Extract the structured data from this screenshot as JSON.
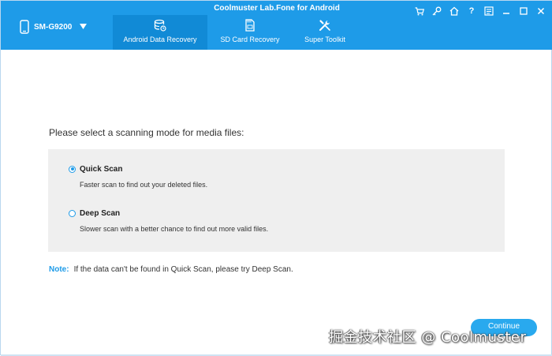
{
  "window": {
    "title": "Coolmuster Lab.Fone for Android",
    "controls": [
      "cart-icon",
      "key-icon",
      "home-icon",
      "help-icon",
      "feedback-icon",
      "minimize-icon",
      "maximize-icon",
      "close-icon"
    ]
  },
  "device": {
    "name": "SM-G9200"
  },
  "tabs": [
    {
      "label": "Android Data Recovery",
      "icon": "database-restore-icon",
      "active": true
    },
    {
      "label": "SD Card Recovery",
      "icon": "sd-card-icon",
      "active": false
    },
    {
      "label": "Super Toolkit",
      "icon": "tools-icon",
      "active": false
    }
  ],
  "main": {
    "prompt": "Please select a scanning mode for media files:",
    "options": [
      {
        "label": "Quick Scan",
        "desc": "Faster scan to find out your deleted files.",
        "selected": true
      },
      {
        "label": "Deep Scan",
        "desc": "Slower scan with a better chance to find out more valid files.",
        "selected": false
      }
    ],
    "note_label": "Note:",
    "note_text": "If the data can't be found in Quick Scan, please try Deep Scan.",
    "continue_label": "Continue"
  },
  "watermark": "掘金技术社区 @ Coolmuster",
  "colors": {
    "accent": "#1e9be8",
    "active_tab": "#118ad6",
    "panel": "#efefef"
  }
}
